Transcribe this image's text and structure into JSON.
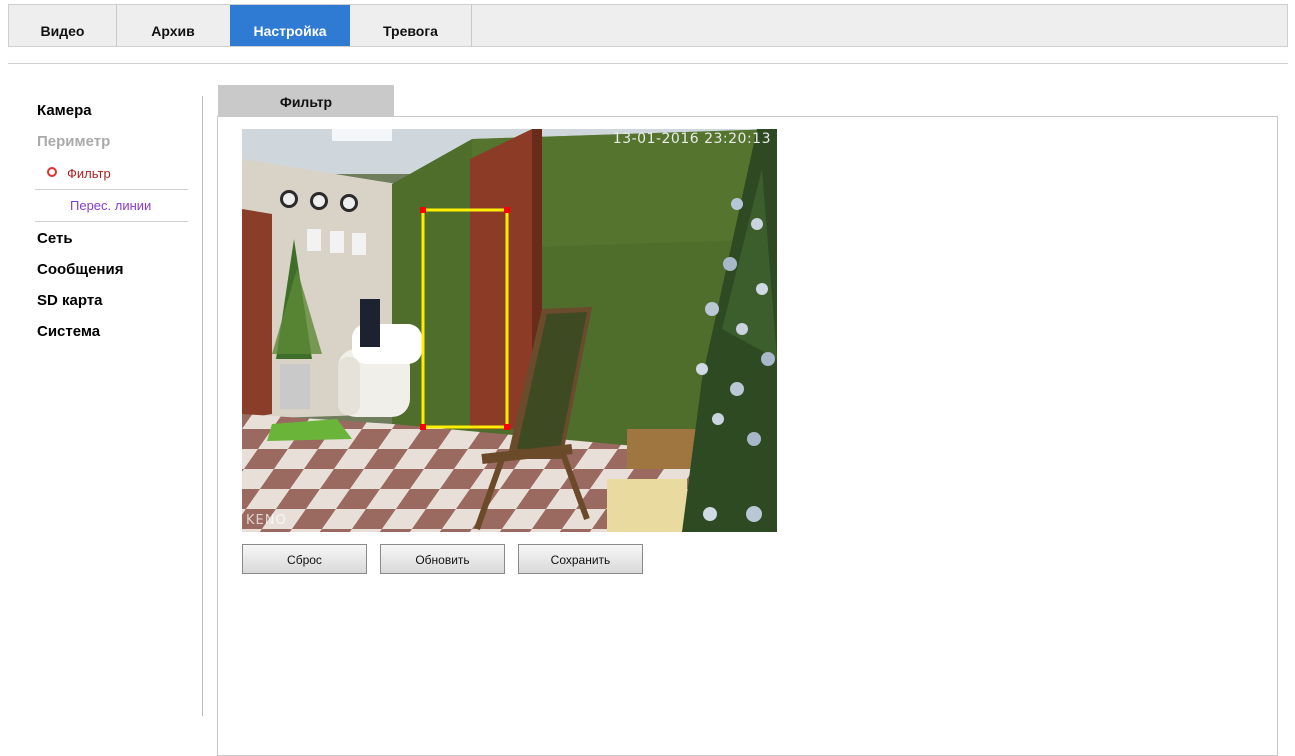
{
  "nav": {
    "tabs": [
      {
        "label": "Видео",
        "active": false
      },
      {
        "label": "Архив",
        "active": false
      },
      {
        "label": "Настройка",
        "active": true
      },
      {
        "label": "Тревога",
        "active": false
      }
    ]
  },
  "sidebar": {
    "camera": "Камера",
    "perimeter": "Периметр",
    "filter": "Фильтр",
    "line_crossing": "Перес. линии",
    "network": "Сеть",
    "messages": "Сообщения",
    "sd_card": "SD карта",
    "system": "Система"
  },
  "panel": {
    "tab_label": "Фильтр"
  },
  "camera_view": {
    "timestamp": "13-01-2016 23:20:13",
    "logo": "KENO"
  },
  "buttons": {
    "reset": "Сброс",
    "refresh": "Обновить",
    "save": "Сохранить"
  },
  "colors": {
    "accent": "#2f7ad3",
    "filter_box": "#ffee00",
    "box_handles": "#ff0000"
  }
}
